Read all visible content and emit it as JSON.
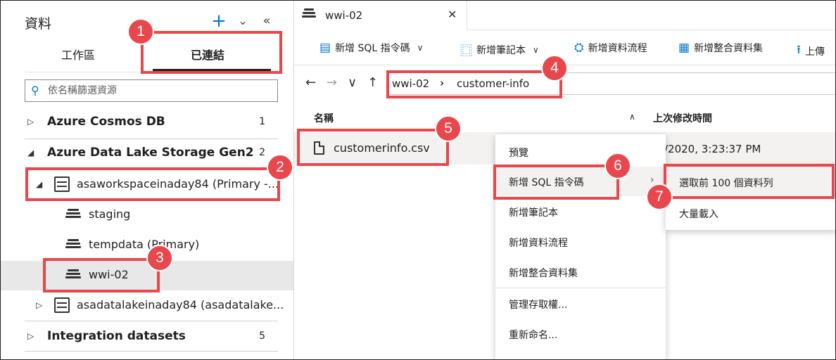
{
  "left_panel": {
    "title": "資料",
    "icons": {
      "add": "plus-icon",
      "expand_all": "double-chevron-down-icon",
      "collapse_panel": "double-chevron-left-icon"
    },
    "tabs": [
      {
        "label": "工作區",
        "selected": false
      },
      {
        "label": "已連結",
        "selected": true
      }
    ],
    "filter": {
      "placeholder": "依名稱篩選資源",
      "value": ""
    },
    "tree": {
      "cosmos": {
        "label": "Azure Cosmos DB",
        "count": "1",
        "expanded": false
      },
      "adls": {
        "label": "Azure Data Lake Storage Gen2",
        "count": "2",
        "expanded": true
      },
      "workspace_account": {
        "label": "asaworkspaceinaday84 (Primary -...",
        "expanded": true
      },
      "staging": {
        "label": "staging"
      },
      "tempdata": {
        "label": "tempdata (Primary)"
      },
      "wwi": {
        "label": "wwi-02",
        "selected": true
      },
      "datalake_account": {
        "label": "asadatalakeinaday84 (asadatalake...",
        "expanded": false
      },
      "integration": {
        "label": "Integration datasets",
        "count": "5",
        "expanded": false
      }
    }
  },
  "doc_tab": {
    "label": "wwi-02"
  },
  "toolbar": {
    "new_sql": "新增 SQL 指令碼",
    "new_notebook": "新增筆記本",
    "new_dataflow": "新增資料流程",
    "new_dataset": "新增整合資料集",
    "upload": "上傳"
  },
  "breadcrumb": [
    "wwi-02",
    "customer-info"
  ],
  "columns": {
    "name": "名稱",
    "modified": "上次修改時間"
  },
  "file": {
    "name": "customerinfo.csv",
    "modified": "/2020, 3:23:37 PM"
  },
  "context_menu": {
    "items": [
      "預覽",
      "新增 SQL 指令碼",
      "新增筆記本",
      "新增資料流程",
      "新增整合資料集",
      "管理存取權...",
      "重新命名..."
    ],
    "highlighted": "新增 SQL 指令碼"
  },
  "submenu": {
    "items": [
      "選取前 100 個資料列",
      "大量載入"
    ],
    "highlighted": "選取前 100 個資料列"
  },
  "callouts": [
    "1",
    "2",
    "3",
    "4",
    "5",
    "6",
    "7"
  ],
  "colors": {
    "accent": "#0078d4",
    "callout": "#e8474c",
    "selected_row": "#e8e8e8"
  }
}
